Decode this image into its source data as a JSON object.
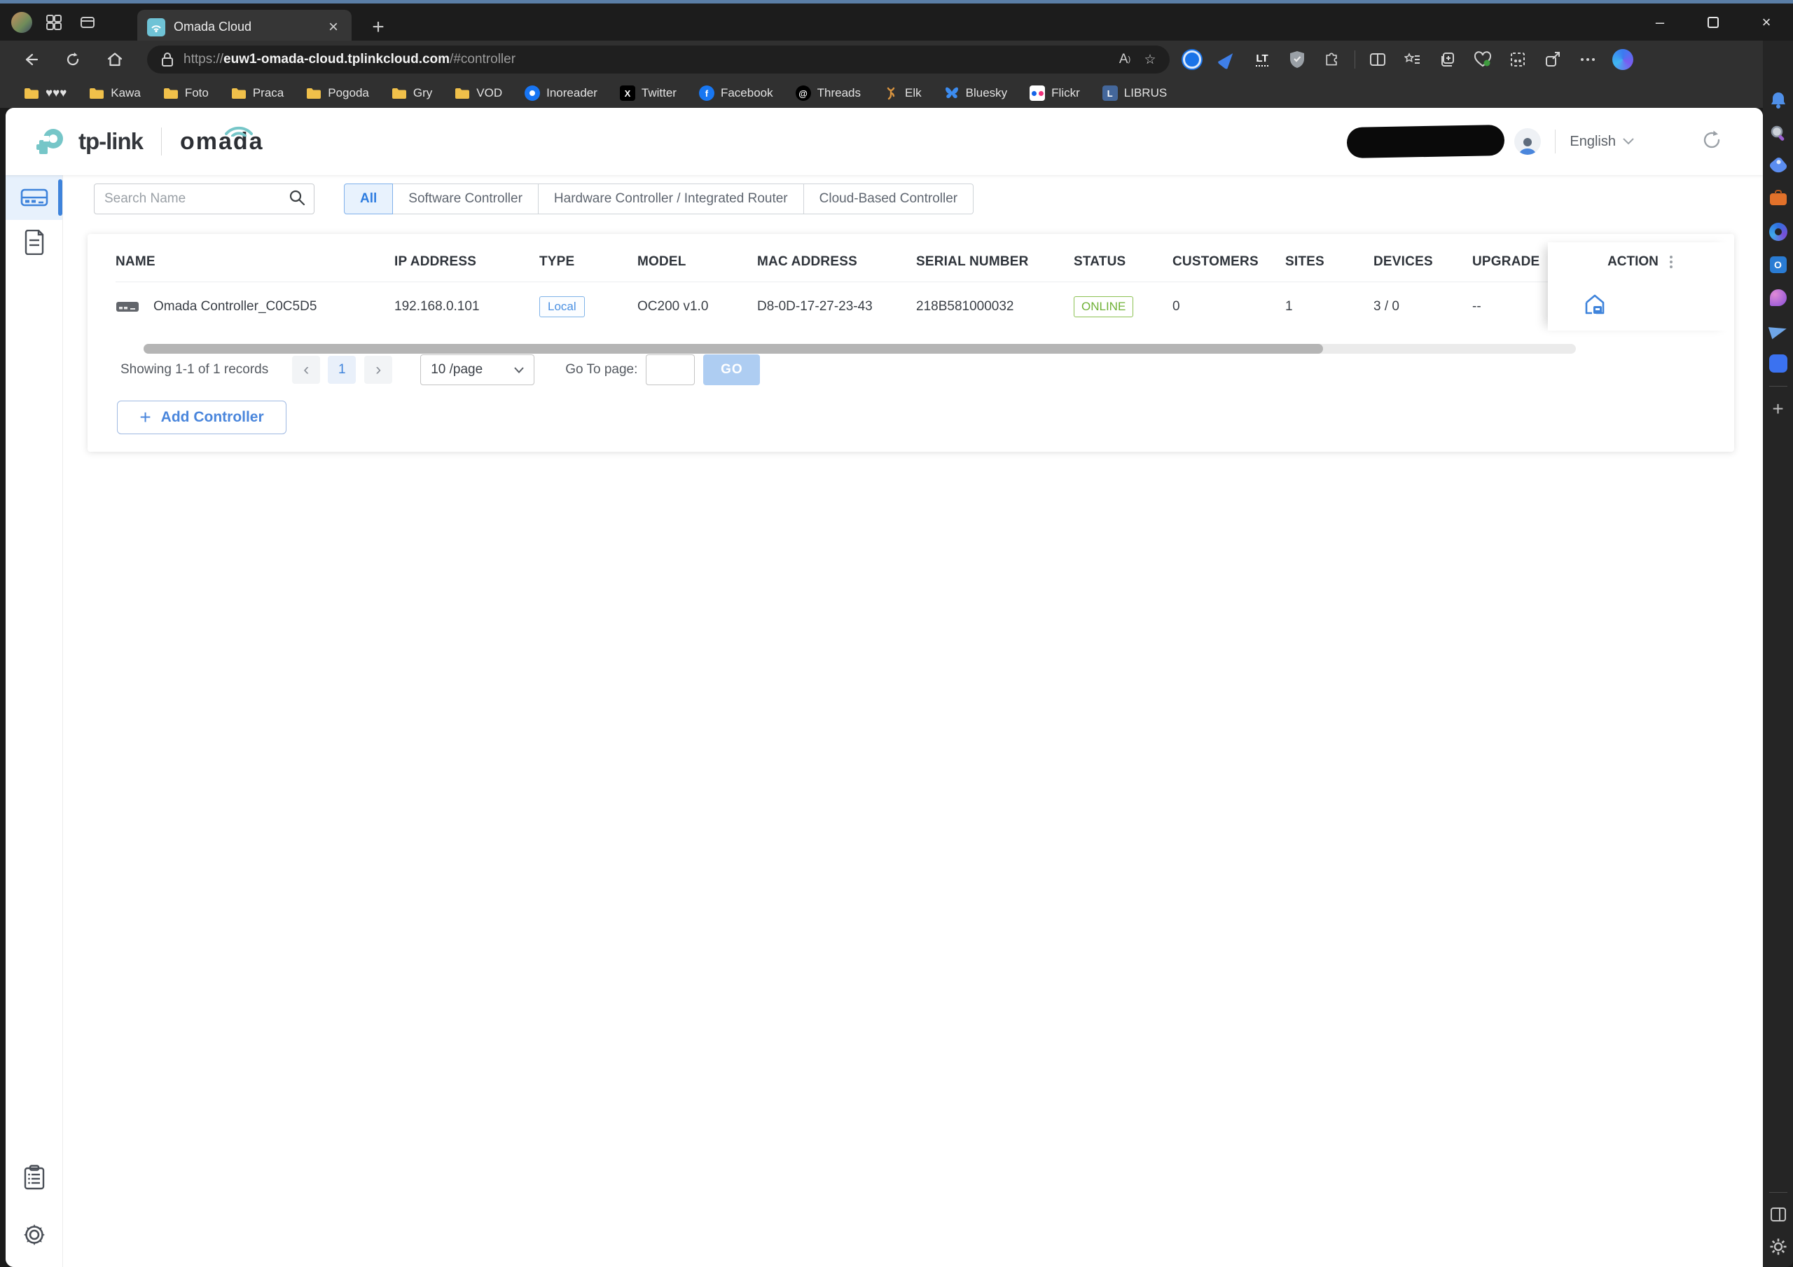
{
  "browser": {
    "tab_title": "Omada Cloud",
    "new_tab_glyph": "+",
    "close_glyph": "×",
    "minimize_glyph": "–",
    "url": {
      "scheme": "https://",
      "host": "euw1-omada-cloud.tplinkcloud.com",
      "path": "/#controller"
    },
    "more_menu_glyph": "⋯",
    "bookmarks": [
      {
        "label": "♥♥♥",
        "icon": "folder"
      },
      {
        "label": "Kawa",
        "icon": "folder"
      },
      {
        "label": "Foto",
        "icon": "folder"
      },
      {
        "label": "Praca",
        "icon": "folder"
      },
      {
        "label": "Pogoda",
        "icon": "folder"
      },
      {
        "label": "Gry",
        "icon": "folder"
      },
      {
        "label": "VOD",
        "icon": "folder"
      },
      {
        "label": "Inoreader",
        "icon": "inoreader"
      },
      {
        "label": "Twitter",
        "icon": "twitter-x"
      },
      {
        "label": "Facebook",
        "icon": "facebook"
      },
      {
        "label": "Threads",
        "icon": "threads"
      },
      {
        "label": "Elk",
        "icon": "elk"
      },
      {
        "label": "Bluesky",
        "icon": "bluesky"
      },
      {
        "label": "Flickr",
        "icon": "flickr"
      },
      {
        "label": "LIBRUS",
        "icon": "librus"
      }
    ],
    "bookmark_glyphs": {
      "twitter": "X",
      "facebook": "f",
      "threads": "@",
      "elk": "🦌",
      "bluesky": "🦋",
      "librus": "L",
      "outlook": "O"
    }
  },
  "header": {
    "brand_primary": "tp-link",
    "brand_secondary": "omada",
    "language": "English"
  },
  "filters": {
    "search_placeholder": "Search Name",
    "tabs": [
      {
        "label": "All",
        "active": true
      },
      {
        "label": "Software Controller",
        "active": false
      },
      {
        "label": "Hardware Controller / Integrated Router",
        "active": false
      },
      {
        "label": "Cloud-Based Controller",
        "active": false
      }
    ]
  },
  "table": {
    "columns": [
      "NAME",
      "IP ADDRESS",
      "TYPE",
      "MODEL",
      "MAC ADDRESS",
      "SERIAL NUMBER",
      "STATUS",
      "CUSTOMERS",
      "SITES",
      "DEVICES",
      "UPGRADE",
      "ACTION"
    ],
    "row": {
      "name": "Omada Controller_C0C5D5",
      "ip": "192.168.0.101",
      "type": "Local",
      "model": "OC200 v1.0",
      "mac": "D8-0D-17-27-23-43",
      "serial": "218B581000032",
      "status": "ONLINE",
      "customers": "0",
      "sites": "1",
      "devices": "3 / 0",
      "upgrade": "--"
    }
  },
  "pagination": {
    "summary": "Showing 1-1 of 1 records",
    "prev_glyph": "‹",
    "page": "1",
    "next_glyph": "›",
    "per_page": "10 /page",
    "goto_label": "Go To page:",
    "go_label": "GO"
  },
  "add_controller_label": "Add Controller",
  "colors": {
    "accent_blue": "#3e83db",
    "online_green": "#6fb136",
    "brand_teal": "#6fc3d6"
  }
}
